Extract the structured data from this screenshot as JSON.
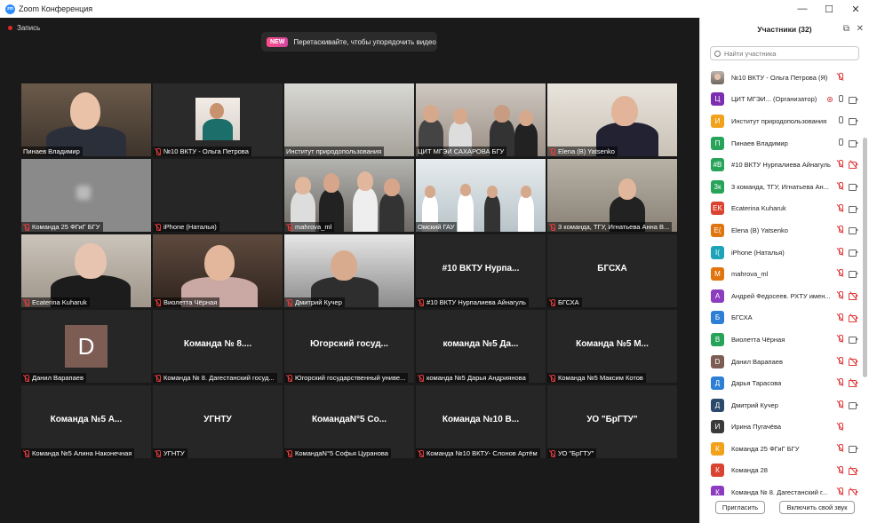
{
  "window": {
    "title": "Zoom Конференция",
    "logo_text": "zm"
  },
  "window_controls": {
    "minimize": "—",
    "maximize": "☐",
    "close": "✕"
  },
  "recording": {
    "label": "Запись"
  },
  "banner": {
    "badge": "NEW",
    "text": "Перетаскивайте, чтобы упорядочить видео"
  },
  "tiles": [
    {
      "label": "Пинаев Владимир",
      "kind": "video",
      "active": true,
      "muted": false
    },
    {
      "label": "№10 ВКТУ - Ольга Петрова",
      "kind": "video",
      "muted": true
    },
    {
      "label": "Институт природопользования",
      "kind": "video",
      "muted": false
    },
    {
      "label": "ЦИТ МГЭИ САХАРОВА БГУ",
      "kind": "video",
      "muted": false
    },
    {
      "label": "Elena (B) Yatsenko",
      "kind": "video",
      "muted": true
    },
    {
      "label": "Команда 25 ФГиГ БГУ",
      "kind": "video",
      "muted": true
    },
    {
      "label": "iPhone (Наталья)",
      "kind": "video",
      "muted": true
    },
    {
      "label": "mahrova_ml",
      "kind": "video",
      "muted": true
    },
    {
      "label": "Омский ГАУ",
      "kind": "video",
      "muted": false
    },
    {
      "label": "3 команда, ТГУ, Игнатьева Анна В...",
      "kind": "video",
      "muted": true
    },
    {
      "label": "Ecaterina Kuharuk",
      "kind": "video",
      "muted": true
    },
    {
      "label": "Виолетта Чёрная",
      "kind": "video",
      "muted": true
    },
    {
      "label": "Дмитрий Кучер",
      "kind": "video",
      "muted": true
    },
    {
      "label": "#10 ВКТУ Нурпалиева Айнагуль",
      "kind": "name",
      "big": "#10 ВКТУ Нурпа...",
      "muted": true
    },
    {
      "label": "БГСХА",
      "kind": "name",
      "big": "БГСХА",
      "muted": true
    },
    {
      "label": "Данил Варапаев",
      "kind": "avatar",
      "big": "D",
      "muted": true
    },
    {
      "label": "Команда № 8. Дагестанский госуд...",
      "kind": "name",
      "big": "Команда № 8....",
      "muted": true
    },
    {
      "label": "Югорский государственный униве...",
      "kind": "name",
      "big": "Югорский госуд...",
      "muted": true
    },
    {
      "label": "команда №5 Дарья Андриянова",
      "kind": "name",
      "big": "команда №5 Да...",
      "muted": true
    },
    {
      "label": "Команда №5 Максим Котов",
      "kind": "name",
      "big": "Команда №5 М...",
      "muted": true
    },
    {
      "label": "Команда №5 Алина Наконечная",
      "kind": "name",
      "big": "Команда №5 А...",
      "muted": true
    },
    {
      "label": "УГНТУ",
      "kind": "name",
      "big": "УГНТУ",
      "muted": true
    },
    {
      "label": "КомандаN°5 Софья Цуранова",
      "kind": "name",
      "big": "КомандаN°5 Со...",
      "muted": true
    },
    {
      "label": "Команда №10 ВКТУ- Слонов Артём",
      "kind": "name",
      "big": "Команда №10 В...",
      "muted": true
    },
    {
      "label": "УО \"БрГТУ\"",
      "kind": "name",
      "big": "УО \"БрГТУ\"",
      "muted": true
    }
  ],
  "panel": {
    "title": "Участники (32)",
    "popout_icon": "popout-icon",
    "close_icon": "close-icon",
    "search_placeholder": "Найти участника",
    "invite_label": "Пригласить",
    "unmute_label": "Включить свой звук"
  },
  "participants": [
    {
      "avatar": "",
      "color": "#8c8c8c",
      "photo": true,
      "name": "№10 ВКТУ - Ольга Петрова (Я)",
      "mic": "off",
      "cam": "none"
    },
    {
      "avatar": "Ц",
      "color": "#7b2fb0",
      "name": "ЦИТ МГЭИ... (Организатор)",
      "mic": "on",
      "cam": "on",
      "rec": true
    },
    {
      "avatar": "И",
      "color": "#f2a21a",
      "name": "Институт природопользования",
      "mic": "on",
      "cam": "on"
    },
    {
      "avatar": "П",
      "color": "#27a35a",
      "name": "Пинаев Владимир",
      "mic": "on",
      "cam": "on"
    },
    {
      "avatar": "#В",
      "color": "#27a35a",
      "name": "#10 ВКТУ Нурпалиева Айнагуль",
      "mic": "off",
      "cam": "off"
    },
    {
      "avatar": "3к",
      "color": "#27a35a",
      "name": "3 команда, ТГУ, Игнатьева Ан...",
      "mic": "off",
      "cam": "on"
    },
    {
      "avatar": "EK",
      "color": "#d9432f",
      "name": "Ecaterina Kuharuk",
      "mic": "off",
      "cam": "on"
    },
    {
      "avatar": "E(",
      "color": "#e0750f",
      "name": "Elena (B) Yatsenko",
      "mic": "off",
      "cam": "on"
    },
    {
      "avatar": "I(",
      "color": "#1ea3b8",
      "name": "iPhone (Наталья)",
      "mic": "off",
      "cam": "on"
    },
    {
      "avatar": "M",
      "color": "#e0750f",
      "name": "mahrova_ml",
      "mic": "off",
      "cam": "on"
    },
    {
      "avatar": "А",
      "color": "#8d3bbf",
      "name": "Андрей Федосеев. РХТУ имен...",
      "mic": "off",
      "cam": "off"
    },
    {
      "avatar": "Б",
      "color": "#2d7fd6",
      "name": "БГСХА",
      "mic": "off",
      "cam": "off"
    },
    {
      "avatar": "В",
      "color": "#27a35a",
      "name": "Виолетта Чёрная",
      "mic": "off",
      "cam": "on"
    },
    {
      "avatar": "D",
      "color": "#7d5d53",
      "name": "Данил Варапаев",
      "mic": "off",
      "cam": "off"
    },
    {
      "avatar": "Д",
      "color": "#2d7fd6",
      "name": "Дарья Тарасова",
      "mic": "off",
      "cam": "off"
    },
    {
      "avatar": "Д",
      "color": "#2b4a6b",
      "name": "Дмитрий Кучер",
      "mic": "off",
      "cam": "on"
    },
    {
      "avatar": "И",
      "color": "#3a3a3a",
      "name": "Ирина Пугачёва",
      "mic": "off",
      "cam": "none"
    },
    {
      "avatar": "К",
      "color": "#f2a21a",
      "name": "Команда 25 ФГиГ БГУ",
      "mic": "off",
      "cam": "on"
    },
    {
      "avatar": "К",
      "color": "#d9432f",
      "name": "Команда 28",
      "mic": "off",
      "cam": "off"
    },
    {
      "avatar": "К",
      "color": "#8d3bbf",
      "name": "Команда № 8. Дагестанский г...",
      "mic": "off",
      "cam": "off"
    }
  ]
}
